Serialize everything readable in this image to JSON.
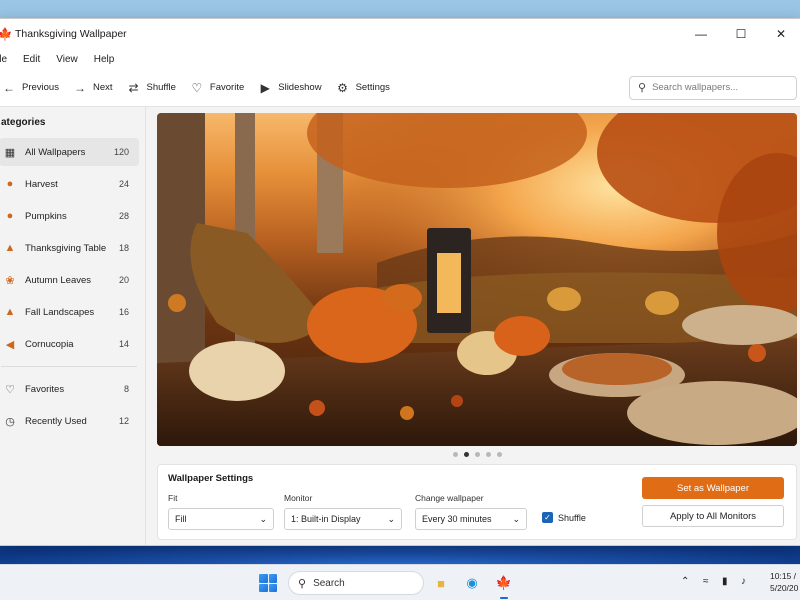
{
  "window": {
    "title": "Thanksgiving Wallpaper"
  },
  "menu": [
    "ile",
    "Edit",
    "View",
    "Help"
  ],
  "toolbar": {
    "previous": "Previous",
    "next": "Next",
    "shuffle": "Shuffle",
    "favorite": "Favorite",
    "slideshow": "Slideshow",
    "settings": "Settings"
  },
  "search": {
    "placeholder": "Search wallpapers..."
  },
  "sidebar": {
    "heading": "ategories",
    "categories": [
      {
        "label": "All Wallpapers",
        "count": "120",
        "icon": "grid-icon"
      },
      {
        "label": "Harvest",
        "count": "24",
        "icon": "pumpkin-icon"
      },
      {
        "label": "Pumpkins",
        "count": "28",
        "icon": "pumpkin-icon"
      },
      {
        "label": "Thanksgiving Table",
        "count": "18",
        "icon": "turkey-icon"
      },
      {
        "label": "Autumn Leaves",
        "count": "20",
        "icon": "leaf-icon"
      },
      {
        "label": "Fall Landscapes",
        "count": "16",
        "icon": "landscape-icon"
      },
      {
        "label": "Cornucopia",
        "count": "14",
        "icon": "cornucopia-icon"
      }
    ],
    "extras": [
      {
        "label": "Favorites",
        "count": "8",
        "icon": "heart-icon"
      },
      {
        "label": "Recently Used",
        "count": "12",
        "icon": "clock-icon"
      }
    ]
  },
  "carousel": {
    "total": 5,
    "active_index": 1
  },
  "wallpaper_settings": {
    "title": "Wallpaper Settings",
    "fit": {
      "label": "Fit",
      "value": "Fill"
    },
    "monitor": {
      "label": "Monitor",
      "value": "1: Built-in Display"
    },
    "change": {
      "label": "Change wallpaper",
      "value": "Every 30 minutes"
    },
    "shuffle": {
      "label": "Shuffle",
      "checked": true
    },
    "set_button": "Set as Wallpaper",
    "apply_button": "Apply to All Monitors"
  },
  "taskbar": {
    "search_label": "Search",
    "time": "10:15 /",
    "date": "5/20/20"
  },
  "colors": {
    "accent": "#e06c16",
    "checkbox": "#1b64b7"
  }
}
